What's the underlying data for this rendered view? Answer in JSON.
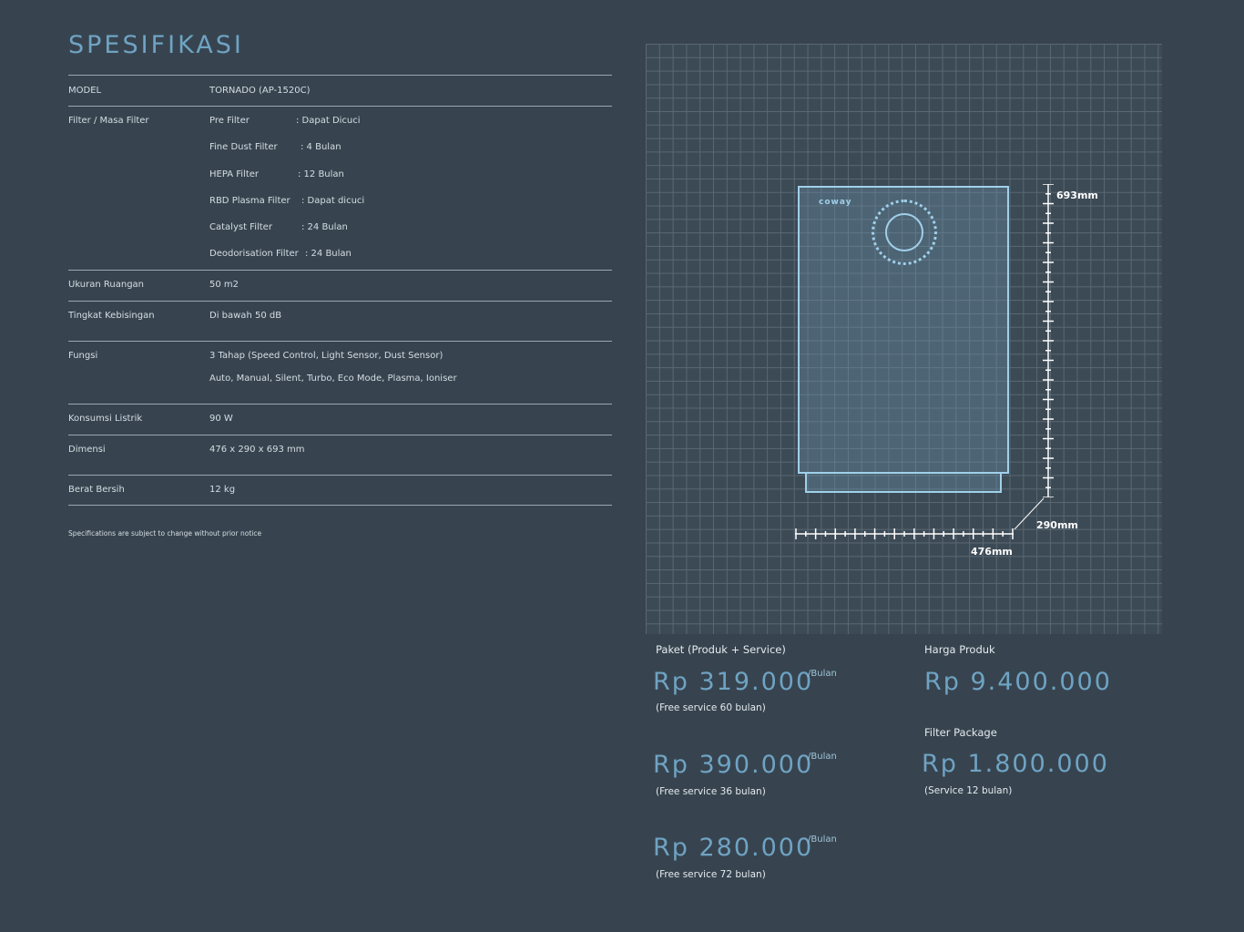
{
  "title": "SPESIFIKASI",
  "specs": {
    "model_label": "MODEL",
    "model_value": "TORNADO (AP-1520C)",
    "filter_label": "Filter / Masa Filter",
    "filters": [
      {
        "name": "Pre Filter",
        "value": ": Dapat Dicuci"
      },
      {
        "name": "Fine Dust Filter",
        "value": ": 4 Bulan"
      },
      {
        "name": "HEPA Filter",
        "value": ": 12 Bulan"
      },
      {
        "name": "RBD Plasma Filter",
        "value": ": Dapat dicuci"
      },
      {
        "name": "Catalyst Filter",
        "value": ": 24 Bulan"
      },
      {
        "name": "Deodorisation Filter",
        "value": ": 24 Bulan"
      }
    ],
    "room_label": "Ukuran Ruangan",
    "room_value": "50 m2",
    "noise_label": "Tingkat Kebisingan",
    "noise_value": "Di bawah 50 dB",
    "function_label": "Fungsi",
    "function_value_1": "3 Tahap (Speed Control, Light Sensor, Dust Sensor)",
    "function_value_2": "Auto, Manual, Silent, Turbo, Eco Mode, Plasma, Ioniser",
    "power_label": "Konsumsi Listrik",
    "power_value": "90 W",
    "dimension_label": "Dimensi",
    "dimension_value": "476 x 290 x 693 mm",
    "weight_label": "Berat Bersih",
    "weight_value": "12 kg"
  },
  "note": "Specifications are subject to change without prior notice",
  "diagram": {
    "brand": "coway",
    "height_label": "693mm",
    "depth_label": "290mm",
    "width_label": "476mm"
  },
  "pricing": {
    "package_label": "Paket (Produk + Service)",
    "per_month": "/Bulan",
    "plans": [
      {
        "price": "Rp 319.000",
        "note": "(Free service 60 bulan)"
      },
      {
        "price": "Rp 390.000",
        "note": "(Free service 36 bulan)"
      },
      {
        "price": "Rp 280.000",
        "note": "(Free service 72 bulan)"
      }
    ],
    "product_label": "Harga Produk",
    "product_price": "Rp 9.400.000",
    "filter_label": "Filter Package",
    "filter_price": "Rp 1.800.000",
    "filter_note": "(Service 12 bulan)"
  }
}
